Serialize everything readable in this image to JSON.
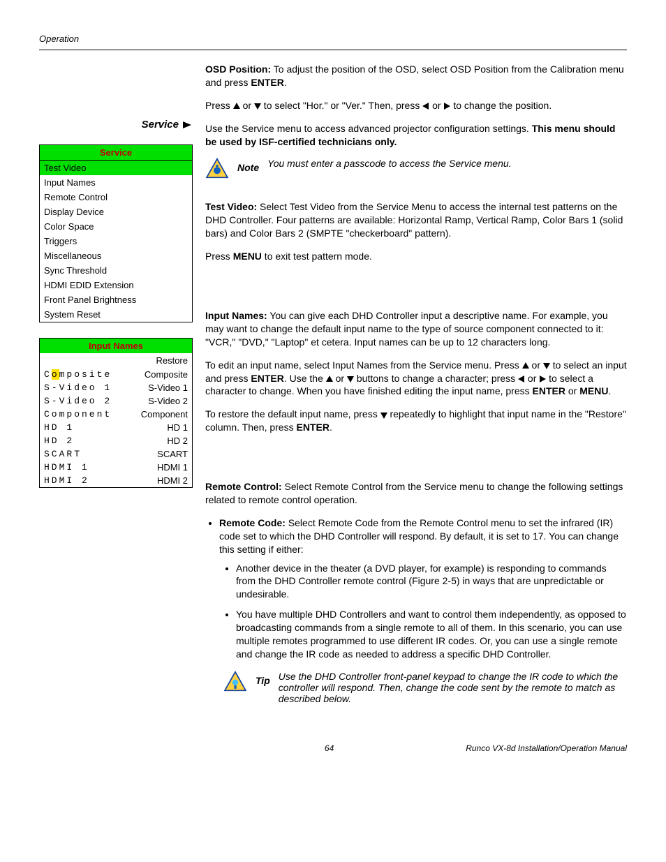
{
  "header": {
    "section": "Operation"
  },
  "osd": {
    "title": "OSD Position:",
    "body1a": " To adjust the position of the OSD, select OSD Position from the Calibration menu and press ",
    "enter": "ENTER",
    "body1b": ".",
    "line2a": "Press ",
    "line2b": " or ",
    "line2c": " to select \"Hor.\" or \"Ver.\" Then, press ",
    "line2d": " or ",
    "line2e": " to change the position."
  },
  "side": {
    "service": "Service"
  },
  "service_intro": {
    "a": "Use the Service menu to access advanced projector configuration settings. ",
    "b": "This menu should be used by ISF-certified technicians only."
  },
  "note1": {
    "label": "Note",
    "text": "You must enter a passcode to access the Service menu."
  },
  "service_menu": {
    "title": "Service",
    "items": [
      "Test Video",
      "Input Names",
      "Remote Control",
      "Display Device",
      "Color Space",
      "Triggers",
      "Miscellaneous",
      "Sync Threshold",
      "HDMI EDID Extension",
      "Front Panel Brightness",
      "System Reset"
    ],
    "selected_index": 0
  },
  "testvideo": {
    "title": "Test Video:",
    "body": " Select Test Video from the Service Menu to access the internal test patterns on the DHD Controller. Four patterns are available: Horizontal Ramp, Vertical Ramp, Color Bars 1 (solid bars) and Color Bars 2 (SMPTE \"checkerboard\" pattern).",
    "exit_a": "Press ",
    "exit_menu": "MENU",
    "exit_b": " to exit test pattern mode."
  },
  "inputnames": {
    "title": "Input Names:",
    "p1": " You can give each DHD Controller input a descriptive name. For example, you may want to change the default input name to the type of source component connected to it: \"VCR,\" \"DVD,\" \"Laptop\" et cetera. Input names can be up to 12 characters long.",
    "p2a": "To edit an input name, select Input Names from the Service menu. Press ",
    "p2b": " or ",
    "p2c": " to select an input and press ",
    "enter": "ENTER",
    "p2d": ". Use the ",
    "p2e": " or ",
    "p2f": " buttons to change a character; press ",
    "p2g": " or ",
    "p2h": " to select a character to change. When you have finished editing the input name, press ",
    "p2i": " or ",
    "menu": "MENU",
    "p2j": ".",
    "p3a": "To restore the default input name, press ",
    "p3b": " repeatedly to highlight that input name in the \"Restore\" column. Then, press ",
    "p3c": "."
  },
  "input_table": {
    "title": "Input Names",
    "restore": "Restore",
    "rows": [
      {
        "left_before": "C",
        "left_cursor": "o",
        "left_after": "mposite",
        "right": "Composite"
      },
      {
        "left_before": "",
        "left_cursor": "",
        "left_after": "S-Video 1",
        "right": "S-Video 1"
      },
      {
        "left_before": "",
        "left_cursor": "",
        "left_after": "S-Video 2",
        "right": "S-Video 2"
      },
      {
        "left_before": "",
        "left_cursor": "",
        "left_after": "Component",
        "right": "Component"
      },
      {
        "left_before": "",
        "left_cursor": "",
        "left_after": "HD 1",
        "right": "HD 1"
      },
      {
        "left_before": "",
        "left_cursor": "",
        "left_after": "HD 2",
        "right": "HD 2"
      },
      {
        "left_before": "",
        "left_cursor": "",
        "left_after": "SCART",
        "right": "SCART"
      },
      {
        "left_before": "",
        "left_cursor": "",
        "left_after": "HDMI 1",
        "right": "HDMI 1"
      },
      {
        "left_before": "",
        "left_cursor": "",
        "left_after": "HDMI 2",
        "right": "HDMI 2"
      }
    ]
  },
  "remote": {
    "title": "Remote Control:",
    "p1": " Select Remote Control from the Service menu to change the following settings related to remote control operation.",
    "li1_title": "Remote Code:",
    "li1_body": " Select Remote Code from the Remote Control menu to set the infrared (IR) code set to which the DHD Controller will respond. By default, it is set to 17. You can change this setting if either:",
    "sub1": "Another device in the theater (a DVD player, for example) is responding to commands from the DHD Controller remote control (Figure 2-5) in ways that are unpredictable or undesirable.",
    "sub2": "You have multiple DHD Controllers and want to control them independently, as opposed to broadcasting commands from a single remote to all of them. In this scenario, you can use multiple remotes programmed to use different IR codes. Or, you can use a single remote and change the IR code as needed to address a specific DHD Controller."
  },
  "tip": {
    "label": "Tip",
    "text": "Use the DHD Controller front-panel keypad to change the IR code to which the controller will respond. Then, change the code sent by the remote to match as described below."
  },
  "footer": {
    "page": "64",
    "title": "Runco VX-8d Installation/Operation Manual"
  }
}
